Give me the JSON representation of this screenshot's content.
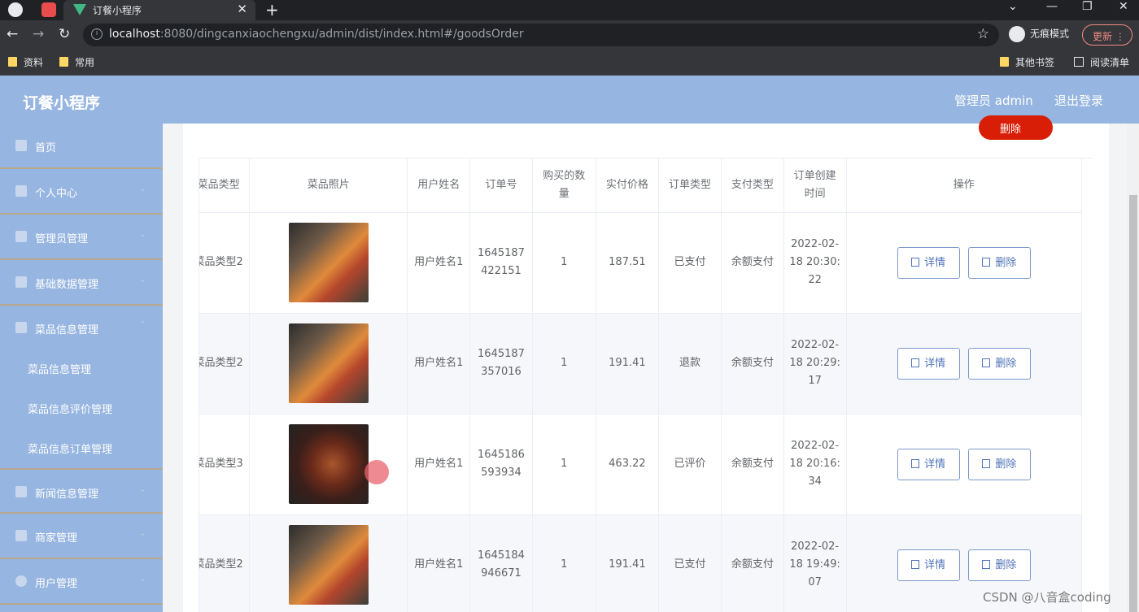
{
  "browser": {
    "tab_title": "订餐小程序",
    "url_host": "localhost",
    "url_rest": ":8080/dingcanxiaochengxu/admin/dist/index.html#/goodsOrder",
    "incognito_label": "无痕模式",
    "update_label": "更新",
    "bookmarks": [
      "资料",
      "常用"
    ],
    "other_bookmarks": "其他书签",
    "reading_list": "阅读清单"
  },
  "header": {
    "title": "订餐小程序",
    "admin_label": "管理员 admin",
    "logout": "退出登录"
  },
  "sidebar": {
    "items": [
      {
        "label": "首页",
        "icon": "home-icon"
      },
      {
        "label": "个人中心",
        "icon": "user-icon"
      },
      {
        "label": "管理员管理",
        "icon": "admin-icon"
      },
      {
        "label": "基础数据管理",
        "icon": "data-icon"
      },
      {
        "label": "菜品信息管理",
        "icon": "dish-icon"
      },
      {
        "label": "新闻信息管理",
        "icon": "news-icon"
      },
      {
        "label": "商家管理",
        "icon": "shop-icon"
      },
      {
        "label": "用户管理",
        "icon": "users-icon"
      }
    ],
    "subitems": [
      "菜品信息管理",
      "菜品信息评价管理",
      "菜品信息订单管理"
    ]
  },
  "toolbar": {
    "delete_label": "删除"
  },
  "table": {
    "headers": [
      "菜品类型",
      "菜品照片",
      "用户姓名",
      "订单号",
      "购买的数量",
      "实付价格",
      "订单类型",
      "支付类型",
      "订单创建时间",
      "操作"
    ],
    "detail_label": "详情",
    "delete_label": "删除",
    "rows": [
      {
        "type": "菜品类型2",
        "user": "用户姓名1",
        "order_no": "1645187422151",
        "qty": "1",
        "price": "187.51",
        "order_type": "已支付",
        "pay_type": "余额支付",
        "created": "2022-02-18 20:30:22"
      },
      {
        "type": "菜品类型2",
        "user": "用户姓名1",
        "order_no": "1645187357016",
        "qty": "1",
        "price": "191.41",
        "order_type": "退款",
        "pay_type": "余额支付",
        "created": "2022-02-18 20:29:17"
      },
      {
        "type": "菜品类型3",
        "user": "用户姓名1",
        "order_no": "1645186593934",
        "qty": "1",
        "price": "463.22",
        "order_type": "已评价",
        "pay_type": "余额支付",
        "created": "2022-02-18 20:16:34"
      },
      {
        "type": "菜品类型2",
        "user": "用户姓名1",
        "order_no": "1645184946671",
        "qty": "1",
        "price": "191.41",
        "order_type": "已支付",
        "pay_type": "余额支付",
        "created": "2022-02-18 19:49:07"
      }
    ]
  },
  "watermark": "CSDN @八音盒coding",
  "colors": {
    "header": "#96b5e0",
    "danger": "#d81e06",
    "primary_outline": "#7b99cc"
  }
}
